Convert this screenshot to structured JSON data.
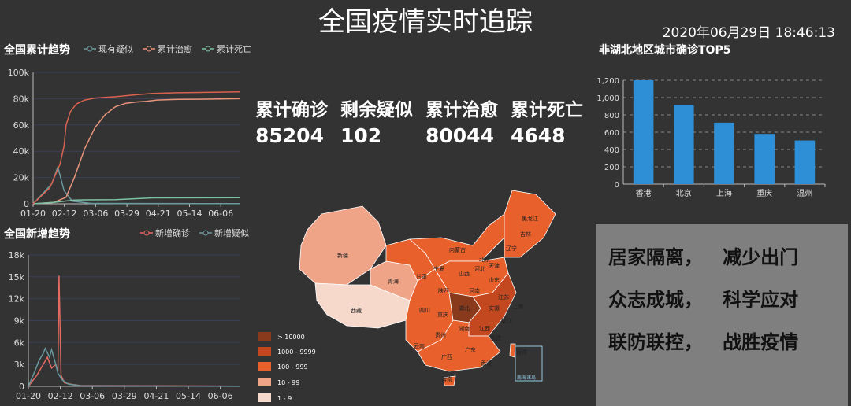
{
  "header": {
    "title": "全国疫情实时追踪",
    "datetime": "2020年06月29日 18:46:13"
  },
  "cumulative_trend": {
    "title": "全国累计趋势",
    "legend": [
      "现有疑似",
      "累计治愈",
      "累计死亡"
    ]
  },
  "new_trend": {
    "title": "全国新增趋势",
    "legend": [
      "新增确诊",
      "新增疑似"
    ]
  },
  "top5": {
    "title": "非湖北地区城市确诊TOP5"
  },
  "stats": {
    "labels": [
      "累计确诊",
      "剩余疑似",
      "累计治愈",
      "累计死亡"
    ],
    "values": [
      "85204",
      "102",
      "80044",
      "4648"
    ]
  },
  "map": {
    "province_labels": [
      "新疆",
      "西藏",
      "青海",
      "甘肃",
      "内蒙古",
      "黑龙江",
      "吉林",
      "辽宁",
      "宁夏",
      "山西",
      "河北",
      "北京",
      "天津",
      "山东",
      "陕西",
      "河南",
      "四川",
      "重庆",
      "湖北",
      "安徽",
      "江苏",
      "上海",
      "浙江",
      "湖南",
      "江西",
      "贵州",
      "云南",
      "广西",
      "广东",
      "福建",
      "台湾",
      "海南",
      "香港",
      "南海诸岛"
    ],
    "legend": [
      "> 10000",
      "1000 - 9999",
      "100 - 999",
      "10 - 99",
      "1 - 9"
    ],
    "legend_colors": [
      "#8a3a1c",
      "#c4481f",
      "#e8612d",
      "#f0a487",
      "#f7d9cc"
    ]
  },
  "slogan": {
    "lines": [
      "居家隔离，   减少出门",
      "众志成城，   科学应对",
      "联防联控，   战胜疫情"
    ]
  },
  "chart_data": [
    {
      "type": "line",
      "title": "全国累计趋势",
      "x": [
        "01-20",
        "02-12",
        "03-06",
        "03-29",
        "04-21",
        "05-14",
        "06-06"
      ],
      "ylim": [
        0,
        100000
      ],
      "yticks": [
        "0",
        "20k",
        "40k",
        "60k",
        "80k",
        "100k"
      ],
      "legend": "top",
      "series": [
        {
          "name": "现有疑似",
          "color": "#6a9a9f",
          "points": [
            [
              0,
              0
            ],
            [
              0.09,
              15000
            ],
            [
              0.12,
              28000
            ],
            [
              0.15,
              10000
            ],
            [
              0.19,
              2000
            ],
            [
              0.28,
              300
            ],
            [
              1,
              100
            ]
          ]
        },
        {
          "name": "累计治愈",
          "color": "#e8957a",
          "points": [
            [
              0,
              0
            ],
            [
              0.1,
              1000
            ],
            [
              0.16,
              5000
            ],
            [
              0.2,
              20000
            ],
            [
              0.25,
              42000
            ],
            [
              0.3,
              58000
            ],
            [
              0.35,
              68000
            ],
            [
              0.4,
              74000
            ],
            [
              0.45,
              76500
            ],
            [
              0.5,
              77500
            ],
            [
              0.55,
              78000
            ],
            [
              0.6,
              79000
            ],
            [
              0.7,
              79500
            ],
            [
              0.8,
              79600
            ],
            [
              1,
              80000
            ]
          ]
        },
        {
          "name": "累计死亡",
          "color": "#7ec2a4",
          "points": [
            [
              0,
              0
            ],
            [
              0.1,
              1000
            ],
            [
              0.15,
              2000
            ],
            [
              0.2,
              2800
            ],
            [
              0.25,
              3000
            ],
            [
              0.4,
              3200
            ],
            [
              0.58,
              4500
            ],
            [
              1,
              4600
            ]
          ]
        },
        {
          "name": "",
          "color": "#d9624f",
          "points": [
            [
              0,
              0
            ],
            [
              0.08,
              12000
            ],
            [
              0.13,
              30000
            ],
            [
              0.15,
              44000
            ],
            [
              0.16,
              60000
            ],
            [
              0.18,
              70000
            ],
            [
              0.21,
              76000
            ],
            [
              0.25,
              79000
            ],
            [
              0.3,
              80500
            ],
            [
              0.4,
              81500
            ],
            [
              0.5,
              83000
            ],
            [
              0.58,
              84000
            ],
            [
              0.7,
              84500
            ],
            [
              1,
              85200
            ]
          ]
        }
      ]
    },
    {
      "type": "line",
      "title": "全国新增趋势",
      "x": [
        "01-20",
        "02-12",
        "03-06",
        "03-29",
        "04-21",
        "05-14",
        "06-06"
      ],
      "ylim": [
        0,
        18000
      ],
      "yticks": [
        "0",
        "3k",
        "6k",
        "9k",
        "12k",
        "15k",
        "18k"
      ],
      "legend": "top",
      "series": [
        {
          "name": "新增确诊",
          "color": "#e46a62",
          "points": [
            [
              0,
              0
            ],
            [
              0.04,
              1500
            ],
            [
              0.07,
              3000
            ],
            [
              0.09,
              4000
            ],
            [
              0.11,
              2500
            ],
            [
              0.13,
              3000
            ],
            [
              0.14,
              2000
            ],
            [
              0.145,
              15150
            ],
            [
              0.155,
              1500
            ],
            [
              0.17,
              500
            ],
            [
              0.2,
              300
            ],
            [
              0.25,
              100
            ],
            [
              1,
              30
            ]
          ]
        },
        {
          "name": "新增疑似",
          "color": "#6a9a9f",
          "points": [
            [
              0,
              0
            ],
            [
              0.03,
              2000
            ],
            [
              0.05,
              3500
            ],
            [
              0.07,
              4500
            ],
            [
              0.08,
              5200
            ],
            [
              0.1,
              4000
            ],
            [
              0.11,
              5000
            ],
            [
              0.13,
              3000
            ],
            [
              0.14,
              1800
            ],
            [
              0.16,
              900
            ],
            [
              0.19,
              300
            ],
            [
              0.25,
              80
            ],
            [
              1,
              10
            ]
          ]
        }
      ]
    },
    {
      "type": "bar",
      "title": "非湖北地区城市确诊TOP5",
      "categories": [
        "香港",
        "北京",
        "上海",
        "重庆",
        "温州"
      ],
      "values": [
        1200,
        910,
        710,
        580,
        504
      ],
      "ylim": [
        0,
        1200
      ],
      "yticks": [
        "0",
        "200",
        "400",
        "600",
        "800",
        "1,000",
        "1,200"
      ],
      "color": "#2f8fd6",
      "grid": true
    }
  ]
}
